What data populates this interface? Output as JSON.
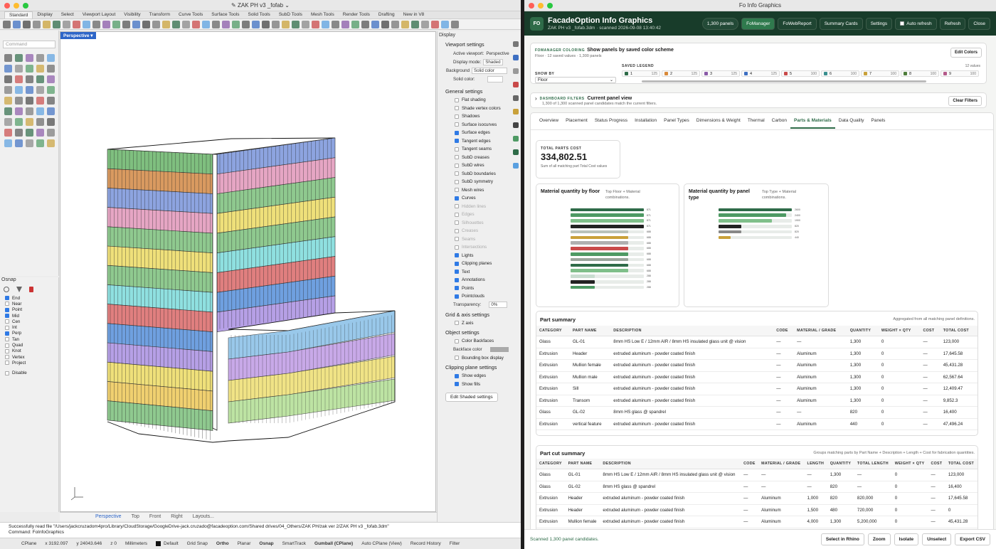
{
  "rhino": {
    "title": "ZAK PH v3 _fofab",
    "tabs": [
      "Standard",
      "Display",
      "Select",
      "Viewport Layout",
      "Visibility",
      "Transform",
      "Curve Tools",
      "Surface Tools",
      "Solid Tools",
      "SubD Tools",
      "Mesh Tools",
      "Render Tools",
      "Drafting",
      "New in V8"
    ],
    "command_placeholder": "Command",
    "viewport_label": "Perspective",
    "osnap": {
      "title": "Osnap",
      "items": [
        {
          "label": "End",
          "on": true
        },
        {
          "label": "Near",
          "on": false
        },
        {
          "label": "Point",
          "on": true
        },
        {
          "label": "Mid",
          "on": true
        },
        {
          "label": "Cen",
          "on": false
        },
        {
          "label": "Int",
          "on": false
        },
        {
          "label": "Perp",
          "on": true
        },
        {
          "label": "Tan",
          "on": false
        },
        {
          "label": "Quad",
          "on": false
        },
        {
          "label": "Knot",
          "on": false
        },
        {
          "label": "Vertex",
          "on": false
        },
        {
          "label": "Project",
          "on": false
        }
      ],
      "disable": "Disable"
    },
    "display": {
      "panel_title": "Display",
      "viewport_settings": "Viewport settings",
      "active_viewport_label": "Active viewport:",
      "active_viewport": "Perspective",
      "display_mode_label": "Display mode:",
      "display_mode": "Shaded",
      "background_label": "Background",
      "background": "Solid color",
      "solid_color_label": "Solid color:",
      "general_settings": "General settings",
      "general": [
        {
          "label": "Flat shading",
          "on": false
        },
        {
          "label": "Shade vertex colors",
          "on": false
        },
        {
          "label": "Shadows",
          "on": false
        },
        {
          "label": "Surface isocurves",
          "on": false
        },
        {
          "label": "Surface edges",
          "on": true
        },
        {
          "label": "Tangent edges",
          "on": true
        },
        {
          "label": "Tangent seams",
          "on": false
        },
        {
          "label": "SubD creases",
          "on": false
        },
        {
          "label": "SubD wires",
          "on": false
        },
        {
          "label": "SubD boundaries",
          "on": false
        },
        {
          "label": "SubD symmetry",
          "on": false
        },
        {
          "label": "Mesh wires",
          "on": false
        },
        {
          "label": "Curves",
          "on": true
        },
        {
          "label": "Hidden lines",
          "on": false,
          "dim": true
        },
        {
          "label": "Edges",
          "on": false,
          "dim": true
        },
        {
          "label": "Silhouettes",
          "on": false,
          "dim": true
        },
        {
          "label": "Creases",
          "on": false,
          "dim": true
        },
        {
          "label": "Seams",
          "on": false,
          "dim": true
        },
        {
          "label": "Intersections",
          "on": false,
          "dim": true
        },
        {
          "label": "Lights",
          "on": true
        },
        {
          "label": "Clipping planes",
          "on": true
        },
        {
          "label": "Text",
          "on": true
        },
        {
          "label": "Annotations",
          "on": true
        },
        {
          "label": "Points",
          "on": true
        },
        {
          "label": "Pointclouds",
          "on": true
        }
      ],
      "transparency_label": "Transparency:",
      "transparency": "0%",
      "grid_axis": "Grid & axis settings",
      "z_axis": "Z axis",
      "object_settings": "Object settings",
      "color_backfaces": "Color Backfaces",
      "backface_color": "Backface color",
      "bounding_box": "Bounding box display",
      "clipping_settings": "Clipping plane settings",
      "show_edges": "Show edges",
      "show_fills": "Show fills",
      "edit_button": "Edit Shaded settings"
    },
    "viewport_tabs": [
      "Perspective",
      "Top",
      "Front",
      "Right",
      "Layouts..."
    ],
    "command_history": [
      "Successfully read file \"/Users/jackcruzadom4pro/Library/CloudStorage/GoogleDrive-jack.cruzado@facadeoption.com/Shared drives/04_Others/ZAK PH/zak ver 2/ZAK PH v3 _fofab.3dm\"",
      "Command: FoInfoGraphics"
    ],
    "status": {
      "cplane": "CPlane",
      "x": "x 3192.097",
      "y": "y 24043.646",
      "z": "z 0",
      "units": "Millimeters",
      "layer": "Default",
      "items": [
        "Grid Snap",
        "Ortho",
        "Planar",
        "Osnap",
        "SmartTrack",
        "Gumball (CPlane)",
        "Auto CPlane (View)",
        "Record History",
        "Filter"
      ]
    }
  },
  "fo": {
    "window_title": "Fo Info Graphics",
    "logo": "FO",
    "title": "FacadeOption Info Graphics",
    "subtitle": "ZAK PH v3 _fofab.3dm · scanned 2026-09-08 13:40:42",
    "header_buttons": {
      "panels": "1,300 panels",
      "fomanager": "FoManager",
      "foweb": "FoWebReport",
      "summary": "Summary Cards",
      "settings": "Settings",
      "auto": "Auto refresh",
      "refresh": "Refresh",
      "close": "Close"
    },
    "coloring": {
      "label": "FOMANAGER COLORING",
      "title": "Show panels by saved color scheme",
      "sub": "Floor · 12 saved values · 1,300 panels",
      "edit": "Edit Colors",
      "show_by_label": "SHOW BY",
      "show_by": "Floor",
      "legend_label": "SAVED LEGEND",
      "legend_count": "12 values",
      "legend": [
        {
          "k": "1",
          "n": "125",
          "c": "#2e6b48"
        },
        {
          "k": "2",
          "n": "125",
          "c": "#d98a3a"
        },
        {
          "k": "3",
          "n": "125",
          "c": "#8a5aa8"
        },
        {
          "k": "4",
          "n": "125",
          "c": "#3d6fc2"
        },
        {
          "k": "5",
          "n": "100",
          "c": "#c94a4a"
        },
        {
          "k": "6",
          "n": "100",
          "c": "#3a8f8f"
        },
        {
          "k": "7",
          "n": "100",
          "c": "#c9a13a"
        },
        {
          "k": "8",
          "n": "100",
          "c": "#4e7d3a"
        },
        {
          "k": "9",
          "n": "100",
          "c": "#b45a8a"
        }
      ]
    },
    "filters": {
      "label": "DASHBOARD FILTERS",
      "title": "Current panel view",
      "sub": "1,300 of 1,300 scanned panel candidates match the current filters.",
      "clear": "Clear Filters"
    },
    "tabs": [
      "Overview",
      "Placement",
      "Status Progress",
      "Installation",
      "Panel Types",
      "Dimensions & Weight",
      "Thermal",
      "Carbon",
      "Parts & Materials",
      "Data Quality",
      "Panels"
    ],
    "active_tab": "Parts & Materials",
    "total": {
      "label": "TOTAL PARTS COST",
      "value": "334,802.51",
      "sub": "Sum of all matching part Total Cost values"
    },
    "chart_data": [
      {
        "type": "bar",
        "title": "Material quantity by floor",
        "subtitle": "Top Floor + Material combinations.",
        "bars": [
          {
            "v": 871,
            "c": "#2e6b48"
          },
          {
            "v": 871,
            "c": "#4e9a64"
          },
          {
            "v": 871,
            "c": "#7fbf8a"
          },
          {
            "v": 871,
            "c": "#222"
          },
          {
            "v": 688,
            "c": "#b9c2ba"
          },
          {
            "v": 688,
            "c": "#c9a13a"
          },
          {
            "v": 688,
            "c": "#b0b0b0"
          },
          {
            "v": 688,
            "c": "#c94a4a"
          },
          {
            "v": 688,
            "c": "#4e9a64"
          },
          {
            "v": 688,
            "c": "#9aa59c"
          },
          {
            "v": 688,
            "c": "#2e6b48"
          },
          {
            "v": 688,
            "c": "#7fbf8a"
          },
          {
            "v": 288,
            "c": "#c9ddd0"
          },
          {
            "v": 288,
            "c": "#222"
          },
          {
            "v": 288,
            "c": "#4e9a64"
          }
        ],
        "max": 871
      },
      {
        "type": "bar",
        "title": "Material quantity by panel type",
        "subtitle": "Top Type + Material combinations.",
        "bars": [
          {
            "v": 2600,
            "c": "#2e6b48"
          },
          {
            "v": 2400,
            "c": "#4e9a64"
          },
          {
            "v": 1900,
            "c": "#7fbf8a"
          },
          {
            "v": 820,
            "c": "#222"
          },
          {
            "v": 820,
            "c": "#888"
          },
          {
            "v": 440,
            "c": "#c9a13a"
          }
        ],
        "max": 2600
      }
    ],
    "part_summary": {
      "title": "Part summary",
      "note": "Aggregated from all matching panel definitions.",
      "headers": [
        "CATEGORY",
        "PART NAME",
        "DESCRIPTION",
        "CODE",
        "MATERIAL / GRADE",
        "QUANTITY",
        "WEIGHT × QTY",
        "COST",
        "TOTAL COST"
      ],
      "rows": [
        [
          "Glass",
          "GL-01",
          "8mm HS Low E / 12mm AIR / 8mm HS insulated glass unit @ vision",
          "—",
          "—",
          "1,300",
          "0",
          "—",
          "123,000"
        ],
        [
          "Extrusion",
          "Header",
          "extruded aluminum - powder coated finish",
          "—",
          "Aluminum",
          "1,300",
          "0",
          "—",
          "17,645.58"
        ],
        [
          "Extrusion",
          "Mullion female",
          "extruded aluminum - powder coated finish",
          "—",
          "Aluminum",
          "1,300",
          "0",
          "—",
          "45,431.28"
        ],
        [
          "Extrusion",
          "Mullion male",
          "extruded aluminum - powder coated finish",
          "—",
          "Aluminum",
          "1,300",
          "0",
          "—",
          "62,567.64"
        ],
        [
          "Extrusion",
          "Sill",
          "extruded aluminum - powder coated finish",
          "—",
          "Aluminum",
          "1,300",
          "0",
          "—",
          "12,409.47"
        ],
        [
          "Extrusion",
          "Transom",
          "extruded aluminum - powder coated finish",
          "—",
          "Aluminum",
          "1,300",
          "0",
          "—",
          "9,852.3"
        ],
        [
          "Glass",
          "GL-02",
          "8mm HS glass @ spandrel",
          "—",
          "—",
          "820",
          "0",
          "—",
          "16,400"
        ],
        [
          "Extrusion",
          "vertical feature",
          "extruded aluminum - powder coated finish",
          "—",
          "Aluminum",
          "440",
          "0",
          "—",
          "47,496.24"
        ]
      ]
    },
    "cut_summary": {
      "title": "Part cut summary",
      "note": "Groups matching parts by Part Name + Description + Length + Cost for fabrication quantities.",
      "headers": [
        "CATEGORY",
        "PART NAME",
        "DESCRIPTION",
        "CODE",
        "MATERIAL / GRADE",
        "LENGTH",
        "QUANTITY",
        "TOTAL LENGTH",
        "WEIGHT × QTY",
        "COST",
        "TOTAL COST"
      ],
      "rows": [
        [
          "Glass",
          "GL-01",
          "8mm HS Low E / 12mm AIR / 8mm HS insulated glass unit @ vision",
          "—",
          "—",
          "—",
          "1,300",
          "—",
          "0",
          "—",
          "123,000"
        ],
        [
          "Glass",
          "GL-02",
          "8mm HS glass @ spandrel",
          "—",
          "—",
          "—",
          "820",
          "—",
          "0",
          "—",
          "16,400"
        ],
        [
          "Extrusion",
          "Header",
          "extruded aluminum - powder coated finish",
          "—",
          "Aluminum",
          "1,000",
          "820",
          "820,000",
          "0",
          "—",
          "17,645.58"
        ],
        [
          "Extrusion",
          "Header",
          "extruded aluminum - powder coated finish",
          "—",
          "Aluminum",
          "1,500",
          "480",
          "720,000",
          "0",
          "—",
          "0"
        ],
        [
          "Extrusion",
          "Mullion female",
          "extruded aluminum - powder coated finish",
          "—",
          "Aluminum",
          "4,000",
          "1,300",
          "5,200,000",
          "0",
          "—",
          "45,431.28"
        ]
      ]
    },
    "footer": {
      "status": "Scanned 1,300 panel candidates.",
      "buttons": [
        "Select in Rhino",
        "Zoom",
        "Isolate",
        "Unselect",
        "Export CSV"
      ]
    }
  }
}
